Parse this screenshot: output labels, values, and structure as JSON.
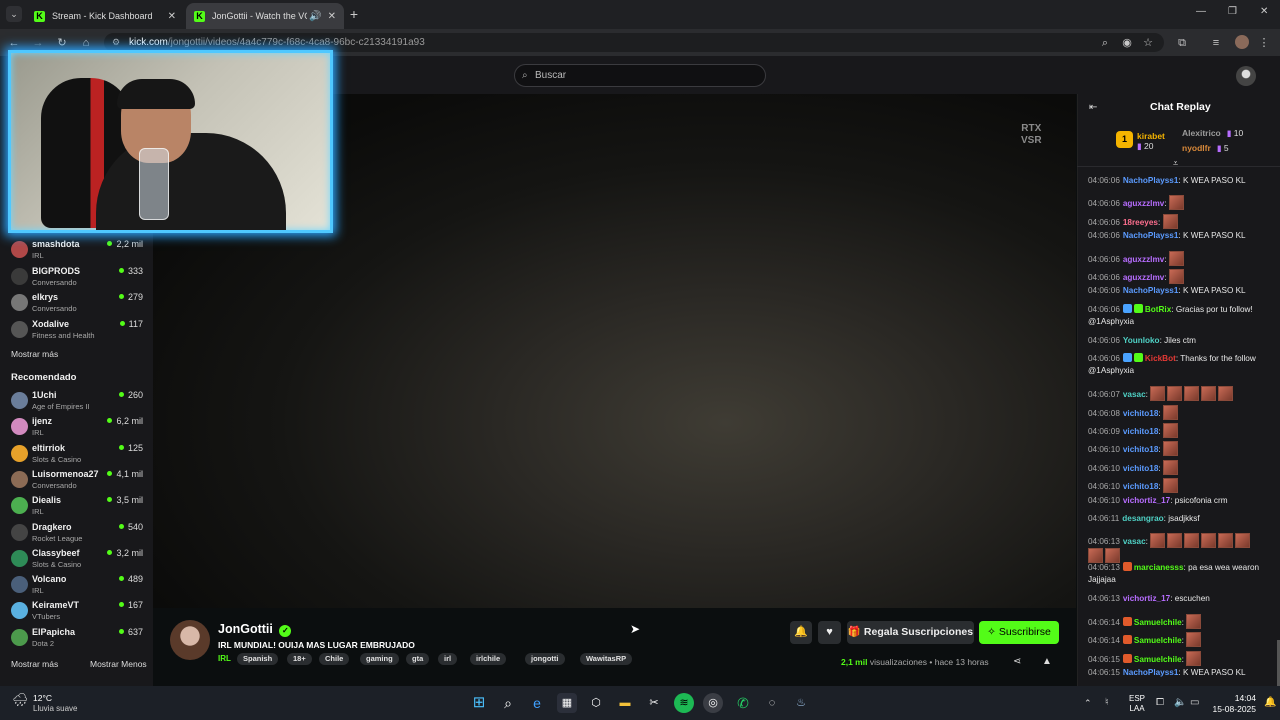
{
  "browser": {
    "tabs": [
      {
        "title": "Stream - Kick Dashboard",
        "active": false
      },
      {
        "title": "JonGottii - Watch the VOD",
        "active": true
      }
    ],
    "url_domain": "kick.com",
    "url_path": "/jongottii/videos/4a4c779c-f68c-4ca8-96bc-c21334191a93"
  },
  "site": {
    "search_placeholder": "Buscar"
  },
  "sidebar": {
    "channels": [
      {
        "name": "smashdota",
        "category": "IRL",
        "viewers": "2,2 mil",
        "color": "#b04848"
      },
      {
        "name": "BIGPRODS",
        "category": "Conversando",
        "viewers": "333",
        "color": "#3a3a3a"
      },
      {
        "name": "elkrys",
        "category": "Conversando",
        "viewers": "279",
        "color": "#777"
      },
      {
        "name": "Xodalive",
        "category": "Fitness and Health",
        "viewers": "117",
        "color": "#555"
      }
    ],
    "show_more": "Mostrar más",
    "recommended_heading": "Recomendado",
    "recommended": [
      {
        "name": "1Uchi",
        "category": "Age of Empires II",
        "viewers": "260",
        "color": "#6a7d9a"
      },
      {
        "name": "ijenz",
        "category": "IRL",
        "viewers": "6,2 mil",
        "color": "#d28abf"
      },
      {
        "name": "eltirriok",
        "category": "Slots & Casino",
        "viewers": "125",
        "color": "#e7a12a"
      },
      {
        "name": "Luisormenoa27",
        "category": "Conversando",
        "viewers": "4,1 mil",
        "color": "#8c6b55"
      },
      {
        "name": "Diealis",
        "category": "IRL",
        "viewers": "3,5 mil",
        "color": "#4caf50"
      },
      {
        "name": "Dragkero",
        "category": "Rocket League",
        "viewers": "540",
        "color": "#444"
      },
      {
        "name": "Classybeef",
        "category": "Slots & Casino",
        "viewers": "3,2 mil",
        "color": "#2e8b57"
      },
      {
        "name": "Volcano",
        "category": "IRL",
        "viewers": "489",
        "color": "#4a5f7a"
      },
      {
        "name": "KeirameVT",
        "category": "VTubers",
        "viewers": "167",
        "color": "#5ab0e0"
      },
      {
        "name": "ElPapicha",
        "category": "Dota 2",
        "viewers": "637",
        "color": "#4c9a4c"
      }
    ],
    "show_more_2": "Mostrar más",
    "show_less": "Mostrar Menos"
  },
  "video": {
    "watermark_1": "RTX",
    "watermark_2": "VSR"
  },
  "stream_info": {
    "streamer": "JonGottii",
    "title": "IRL MUNDIAL! OUIJA MAS LUGAR EMBRUJADO",
    "category": "IRL",
    "tags": [
      "Spanish",
      "18+",
      "Chile",
      "gaming",
      "gta",
      "irl",
      "irlchile",
      "jongotti",
      "WawitasRP"
    ],
    "gift_label": "Regala Suscripciones",
    "subscribe_label": "Suscribirse",
    "views_number": "2,1 mil",
    "views_word": "visualizaciones",
    "time_ago": "hace 13 horas"
  },
  "chat": {
    "title": "Chat Replay",
    "leaderboard": [
      {
        "name": "kirabet",
        "count": "20",
        "color": "#f5b400"
      },
      {
        "name": "Alexitrico",
        "count": "10",
        "color": "#9c9c9c"
      },
      {
        "name": "nyodlfr",
        "count": "5",
        "color": "#d9893a"
      }
    ],
    "messages": [
      {
        "time": "04:06:06",
        "user": "NachoPlayss1",
        "color": "#5b9bff",
        "text": "K WEA PASO KL",
        "emotes": 0
      },
      {
        "time": "04:06:06",
        "user": "aguxzzlmv",
        "color": "#b76dff",
        "text": "",
        "emotes": 1
      },
      {
        "time": "04:06:06",
        "user": "18reeyes",
        "color": "#ff6f8f",
        "text": "",
        "emotes": 1
      },
      {
        "time": "04:06:06",
        "user": "NachoPlayss1",
        "color": "#5b9bff",
        "text": "K WEA PASO KL",
        "emotes": 0
      },
      {
        "time": "04:06:06",
        "user": "aguxzzlmv",
        "color": "#b76dff",
        "text": "",
        "emotes": 1
      },
      {
        "time": "04:06:06",
        "user": "aguxzzlmv",
        "color": "#b76dff",
        "text": "",
        "emotes": 1
      },
      {
        "time": "04:06:06",
        "user": "NachoPlayss1",
        "color": "#5b9bff",
        "text": "K WEA PASO KL",
        "emotes": 0
      },
      {
        "time": "04:06:06",
        "user": "BotRix",
        "color": "#53fc18",
        "text": "Gracias por tu follow!",
        "cont": "@1Asphyxia",
        "emotes": 0,
        "badges": [
          "#4aa3ff",
          "#53fc18"
        ]
      },
      {
        "time": "04:06:06",
        "user": "Younloko",
        "color": "#4fd1c5",
        "text": "Jiles ctm",
        "emotes": 0
      },
      {
        "time": "04:06:06",
        "user": "KickBot",
        "color": "#e53935",
        "text": "Thanks for the follow",
        "cont": "@1Asphyxia",
        "emotes": 0,
        "badges": [
          "#4aa3ff",
          "#53fc18"
        ]
      },
      {
        "time": "04:06:07",
        "user": "vasac",
        "color": "#4fd1c5",
        "text": "",
        "emotes": 5
      },
      {
        "time": "04:06:08",
        "user": "vichito18",
        "color": "#5b9bff",
        "text": "",
        "emotes": 1
      },
      {
        "time": "04:06:09",
        "user": "vichito18",
        "color": "#5b9bff",
        "text": "",
        "emotes": 1
      },
      {
        "time": "04:06:10",
        "user": "vichito18",
        "color": "#5b9bff",
        "text": "",
        "emotes": 1
      },
      {
        "time": "04:06:10",
        "user": "vichito18",
        "color": "#5b9bff",
        "text": "",
        "emotes": 1
      },
      {
        "time": "04:06:10",
        "user": "vichito18",
        "color": "#5b9bff",
        "text": "",
        "emotes": 1
      },
      {
        "time": "04:06:10",
        "user": "vichortiz_17",
        "color": "#b76dff",
        "text": "psicofonia crm",
        "emotes": 0
      },
      {
        "time": "04:06:11",
        "user": "desangrao",
        "color": "#4fd1c5",
        "text": "jsadjkksf",
        "emotes": 0
      },
      {
        "time": "04:06:13",
        "user": "vasac",
        "color": "#4fd1c5",
        "text": "",
        "emotes": 8
      },
      {
        "time": "04:06:13",
        "user": "marcianesss",
        "color": "#53fc18",
        "text": "pa esa wea wearon",
        "cont": "Jajjajaa",
        "emotes": 0,
        "badges": [
          "#e05a2b"
        ]
      },
      {
        "time": "04:06:13",
        "user": "vichortiz_17",
        "color": "#b76dff",
        "text": "escuchen",
        "emotes": 0
      },
      {
        "time": "04:06:14",
        "user": "Samuelchile",
        "color": "#53fc18",
        "text": "",
        "emotes": 1,
        "badges": [
          "#e05a2b"
        ]
      },
      {
        "time": "04:06:14",
        "user": "Samuelchile",
        "color": "#53fc18",
        "text": "",
        "emotes": 1,
        "badges": [
          "#e05a2b"
        ]
      },
      {
        "time": "04:06:15",
        "user": "Samuelchile",
        "color": "#53fc18",
        "text": "",
        "emotes": 1,
        "badges": [
          "#e05a2b"
        ]
      },
      {
        "time": "04:06:15",
        "user": "NachoPlayss1",
        "color": "#5b9bff",
        "text": "K WEA PASO KL",
        "emotes": 0
      }
    ]
  },
  "taskbar": {
    "temperature": "12°C",
    "weather": "Lluvia suave",
    "lang_1": "ESP",
    "lang_2": "LAA",
    "time": "14:04",
    "date": "15-08-2025"
  }
}
